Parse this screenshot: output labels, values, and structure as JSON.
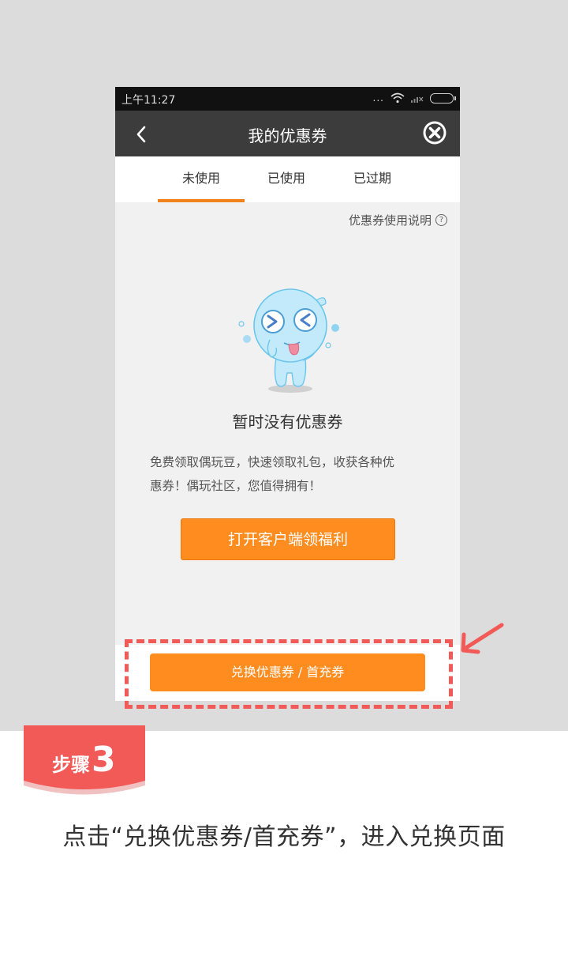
{
  "status_bar": {
    "time": "上午11:27",
    "more": "...",
    "icons": [
      "wifi-icon",
      "signal-icon",
      "battery-icon"
    ]
  },
  "header": {
    "title": "我的优惠券",
    "back_icon": "chevron-left-icon",
    "close_icon": "close-circle-icon"
  },
  "tabs": [
    {
      "label": "未使用",
      "active": true
    },
    {
      "label": "已使用",
      "active": false
    },
    {
      "label": "已过期",
      "active": false
    }
  ],
  "help_link": {
    "label": "优惠券使用说明",
    "icon": "?"
  },
  "empty_state": {
    "title": "暂时没有优惠券",
    "desc_line1": "免费领取偶玩豆，快速领取礼包，收获各种优",
    "desc_line2": "惠券！偶玩社区，您值得拥有！"
  },
  "open_button": {
    "label": "打开客户端领福利"
  },
  "exchange_button": {
    "label": "兑换优惠券 / 首充券"
  },
  "step": {
    "word": "步骤",
    "number": "3"
  },
  "instruction": "点击“兑换优惠券/首充券”，进入兑换页面",
  "colors": {
    "accent": "#ff8c1f",
    "highlight": "#f25a58",
    "header": "#3c3c3c"
  }
}
